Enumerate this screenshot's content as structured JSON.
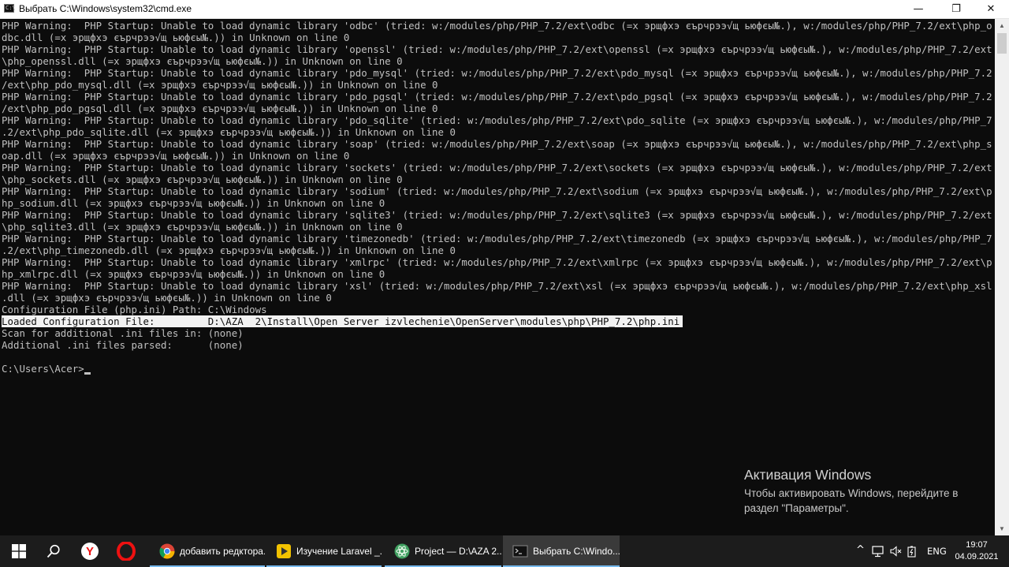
{
  "window": {
    "title": "Выбрать C:\\Windows\\system32\\cmd.exe",
    "icon": "cmd-icon",
    "icon_text": "C:\\",
    "min_glyph": "—",
    "max_glyph": "❐",
    "close_glyph": "✕"
  },
  "console": {
    "lines": [
      "PHP Warning:  PHP Startup: Unable to load dynamic library 'odbc' (tried: w:/modules/php/PHP_7.2/ext\\odbc (=х эрщфхэ єърчрээ√щ ьюфєы№.), w:/modules/php/PHP_7.2/ext\\php_o",
      "dbc.dll (=х эрщфхэ єърчрээ√щ ьюфєы№.)) in Unknown on line 0",
      "PHP Warning:  PHP Startup: Unable to load dynamic library 'openssl' (tried: w:/modules/php/PHP_7.2/ext\\openssl (=х эрщфхэ єърчрээ√щ ьюфєы№.), w:/modules/php/PHP_7.2/ext",
      "\\php_openssl.dll (=х эрщфхэ єърчрээ√щ ьюфєы№.)) in Unknown on line 0",
      "PHP Warning:  PHP Startup: Unable to load dynamic library 'pdo_mysql' (tried: w:/modules/php/PHP_7.2/ext\\pdo_mysql (=х эрщфхэ єърчрээ√щ ьюфєы№.), w:/modules/php/PHP_7.2",
      "/ext\\php_pdo_mysql.dll (=х эрщфхэ єърчрээ√щ ьюфєы№.)) in Unknown on line 0",
      "PHP Warning:  PHP Startup: Unable to load dynamic library 'pdo_pgsql' (tried: w:/modules/php/PHP_7.2/ext\\pdo_pgsql (=х эрщфхэ єърчрээ√щ ьюфєы№.), w:/modules/php/PHP_7.2",
      "/ext\\php_pdo_pgsql.dll (=х эрщфхэ єърчрээ√щ ьюфєы№.)) in Unknown on line 0",
      "PHP Warning:  PHP Startup: Unable to load dynamic library 'pdo_sqlite' (tried: w:/modules/php/PHP_7.2/ext\\pdo_sqlite (=х эрщфхэ єърчрээ√щ ьюфєы№.), w:/modules/php/PHP_7",
      ".2/ext\\php_pdo_sqlite.dll (=х эрщфхэ єърчрээ√щ ьюфєы№.)) in Unknown on line 0",
      "PHP Warning:  PHP Startup: Unable to load dynamic library 'soap' (tried: w:/modules/php/PHP_7.2/ext\\soap (=х эрщфхэ єърчрээ√щ ьюфєы№.), w:/modules/php/PHP_7.2/ext\\php_s",
      "oap.dll (=х эрщфхэ єърчрээ√щ ьюфєы№.)) in Unknown on line 0",
      "PHP Warning:  PHP Startup: Unable to load dynamic library 'sockets' (tried: w:/modules/php/PHP_7.2/ext\\sockets (=х эрщфхэ єърчрээ√щ ьюфєы№.), w:/modules/php/PHP_7.2/ext",
      "\\php_sockets.dll (=х эрщфхэ єърчрээ√щ ьюфєы№.)) in Unknown on line 0",
      "PHP Warning:  PHP Startup: Unable to load dynamic library 'sodium' (tried: w:/modules/php/PHP_7.2/ext\\sodium (=х эрщфхэ єърчрээ√щ ьюфєы№.), w:/modules/php/PHP_7.2/ext\\p",
      "hp_sodium.dll (=х эрщфхэ єърчрээ√щ ьюфєы№.)) in Unknown on line 0",
      "PHP Warning:  PHP Startup: Unable to load dynamic library 'sqlite3' (tried: w:/modules/php/PHP_7.2/ext\\sqlite3 (=х эрщфхэ єърчрээ√щ ьюфєы№.), w:/modules/php/PHP_7.2/ext",
      "\\php_sqlite3.dll (=х эрщфхэ єърчрээ√щ ьюфєы№.)) in Unknown on line 0",
      "PHP Warning:  PHP Startup: Unable to load dynamic library 'timezonedb' (tried: w:/modules/php/PHP_7.2/ext\\timezonedb (=х эрщфхэ єърчрээ√щ ьюфєы№.), w:/modules/php/PHP_7",
      ".2/ext\\php_timezonedb.dll (=х эрщфхэ єърчрээ√щ ьюфєы№.)) in Unknown on line 0",
      "PHP Warning:  PHP Startup: Unable to load dynamic library 'xmlrpc' (tried: w:/modules/php/PHP_7.2/ext\\xmlrpc (=х эрщфхэ єърчрээ√щ ьюфєы№.), w:/modules/php/PHP_7.2/ext\\p",
      "hp_xmlrpc.dll (=х эрщфхэ єърчрээ√щ ьюфєы№.)) in Unknown on line 0",
      "PHP Warning:  PHP Startup: Unable to load dynamic library 'xsl' (tried: w:/modules/php/PHP_7.2/ext\\xsl (=х эрщфхэ єърчрээ√щ ьюфєы№.), w:/modules/php/PHP_7.2/ext\\php_xsl",
      ".dll (=х эрщфхэ єърчрээ√щ ьюфєы№.)) in Unknown on line 0",
      "Configuration File (php.ini) Path: C:\\Windows",
      "Loaded Configuration File:         D:\\AZA  2\\Install\\Open Server izvlechenie\\OpenServer\\modules\\php\\PHP_7.2\\php.ini",
      "Scan for additional .ini files in: (none)",
      "Additional .ini files parsed:      (none)",
      "",
      "C:\\Users\\Acer>"
    ],
    "selected_line_index": 25,
    "colors": {
      "background": "#0c0c0c",
      "text": "#c0c0c0",
      "selection": "#f2f2f2"
    }
  },
  "watermark": {
    "heading": "Активация Windows",
    "line1": "Чтобы активировать Windows, перейдите в",
    "line2": "раздел \"Параметры\"."
  },
  "taskbar": {
    "start_icon": "windows-start-icon",
    "search_icon": "search-icon",
    "pinned": [
      {
        "name": "yandex-browser-icon",
        "letter": "Y",
        "color": "#e11"
      },
      {
        "name": "opera-browser-icon",
        "letter": "O",
        "color": "#e11"
      }
    ],
    "tasks": [
      {
        "label": "добавить редктора...",
        "icon": "chrome-icon",
        "color": "#4285f4"
      },
      {
        "label": "Изучение Laravel _...",
        "icon": "player-icon",
        "color": "#f2c200"
      },
      {
        "label": "Project — D:\\AZA 2...",
        "icon": "atom-icon",
        "color": "#40a060"
      },
      {
        "label": "Выбрать C:\\Windo...",
        "icon": "cmd-icon",
        "color": "#222222"
      }
    ],
    "tray": {
      "chevron": "^",
      "network_icon": "network-icon",
      "speaker_icon": "speaker-icon",
      "battery_icon": "battery-icon",
      "language": "ENG",
      "time": "19:07",
      "date": "04.09.2021"
    }
  }
}
